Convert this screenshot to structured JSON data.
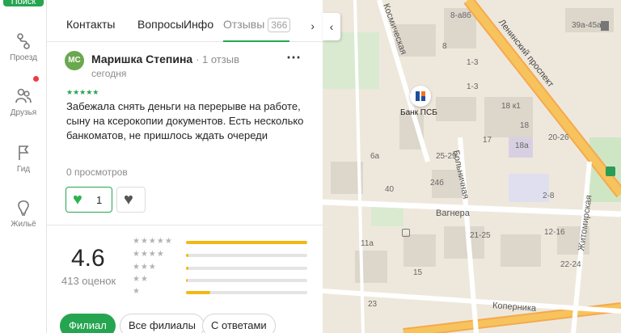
{
  "rail": {
    "search_label": "Поиск",
    "items": [
      {
        "label": "Проезд",
        "icon": "route-icon"
      },
      {
        "label": "Друзья",
        "icon": "friends-icon"
      },
      {
        "label": "Гид",
        "icon": "flag-icon"
      },
      {
        "label": "Жильё",
        "icon": "house-icon"
      }
    ]
  },
  "tabs": [
    {
      "label": "Контакты"
    },
    {
      "label": "Вопросы"
    },
    {
      "label": "Инфо"
    },
    {
      "label": "Отзывы",
      "count": "366"
    }
  ],
  "review": {
    "initials": "МС",
    "author": "Маришка Степина",
    "author_meta": "· 1 отзыв",
    "date": "сегодня",
    "stars": "★★★★★",
    "text": "Забежала снять деньги на перерыве на работе, сыну на ксерокопии документов. Есть несколько банкоматов, не пришлось ждать очереди",
    "views": "0 просмотров",
    "likes": "1"
  },
  "summary": {
    "rating": "4.6",
    "count_label": "413 оценок",
    "distribution": [
      {
        "stars": "★★★★★",
        "fraction": 1.0
      },
      {
        "stars": "★★★★",
        "fraction": 0.02
      },
      {
        "stars": "★★★",
        "fraction": 0.02
      },
      {
        "stars": "★★",
        "fraction": 0.01
      },
      {
        "stars": "★",
        "fraction": 0.2
      }
    ]
  },
  "filters": [
    {
      "label": "Филиал",
      "active": true
    },
    {
      "label": "Все филиалы",
      "active": false
    },
    {
      "label": "С ответами",
      "active": false
    }
  ],
  "map": {
    "streets": [
      "Космическая",
      "Ленинский проспект",
      "Больничная",
      "Вагнера",
      "Житомирская",
      "Коперника"
    ],
    "poi_label": "Банк ПСБ",
    "house_numbers": [
      "8-а8б",
      "39а-45а",
      "8",
      "1-3",
      "1-3",
      "18 к1",
      "18",
      "20-26",
      "17",
      "18а",
      "6а",
      "25-29",
      "24б",
      "40",
      "2-8",
      "12-16",
      "21-25",
      "11а",
      "22-24",
      "15",
      "23"
    ]
  },
  "colors": {
    "accent": "#26a551",
    "star_fill": "#f2b813",
    "road": "#f7c35c",
    "map_bg": "#eee8dc"
  }
}
